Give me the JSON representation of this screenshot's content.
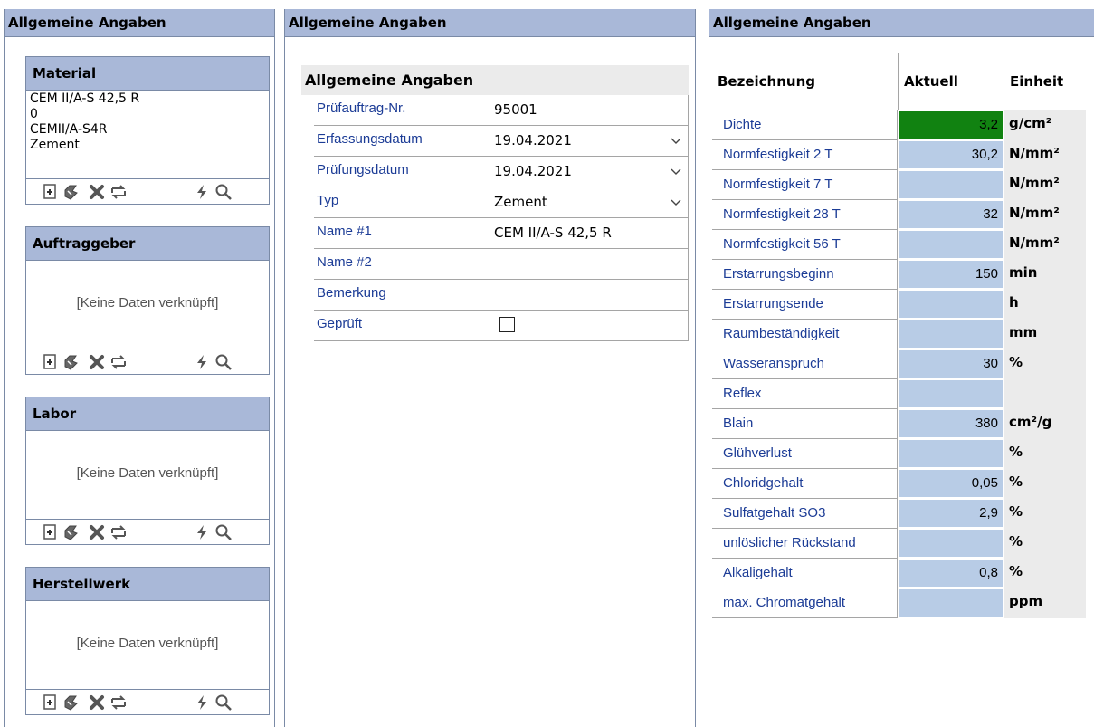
{
  "panels": {
    "left_title": "Allgemeine Angaben",
    "middle_title": "Allgemeine Angaben",
    "right_title": "Allgemeine Angaben"
  },
  "material": {
    "title": "Material",
    "lines": [
      "CEM II/A-S 42,5 R",
      "0",
      "CEMII/A-S4R",
      "Zement"
    ]
  },
  "auftraggeber": {
    "title": "Auftraggeber",
    "empty": "[Keine Daten verknüpft]"
  },
  "labor": {
    "title": "Labor",
    "empty": "[Keine Daten verknüpft]"
  },
  "herstellwerk": {
    "title": "Herstellwerk",
    "empty": "[Keine Daten verknüpft]"
  },
  "toolbar_icons": [
    "add-icon",
    "link-icon",
    "delete-icon",
    "swap-icon",
    "lightning-icon",
    "search-icon"
  ],
  "form": {
    "title": "Allgemeine Angaben",
    "rows": [
      {
        "label": "Prüfauftrag-Nr.",
        "value": "95001"
      },
      {
        "label": "Erfassungsdatum",
        "value": "19.04.2021"
      },
      {
        "label": "Prüfungsdatum",
        "value": "19.04.2021"
      },
      {
        "label": "Typ",
        "value": "Zement"
      },
      {
        "label": "Name #1",
        "value": "CEM II/A-S 42,5 R"
      },
      {
        "label": "Name #2",
        "value": ""
      },
      {
        "label": "Bemerkung",
        "value": ""
      },
      {
        "label": "Geprüft",
        "value": ""
      }
    ]
  },
  "table": {
    "headers": [
      "Bezeichnung",
      "Aktuell",
      "Einheit"
    ],
    "rows": [
      {
        "name": "Dichte",
        "value": "3,2",
        "unit": "g/cm²"
      },
      {
        "name": "Normfestigkeit 2 T",
        "value": "30,2",
        "unit": "N/mm²"
      },
      {
        "name": "Normfestigkeit 7 T",
        "value": "",
        "unit": "N/mm²"
      },
      {
        "name": "Normfestigkeit 28 T",
        "value": "32",
        "unit": "N/mm²"
      },
      {
        "name": "Normfestigkeit 56 T",
        "value": "",
        "unit": "N/mm²"
      },
      {
        "name": "Erstarrungsbeginn",
        "value": "150",
        "unit": "min"
      },
      {
        "name": "Erstarrungsende",
        "value": "",
        "unit": "h"
      },
      {
        "name": "Raumbeständigkeit",
        "value": "",
        "unit": "mm"
      },
      {
        "name": "Wasseranspruch",
        "value": "30",
        "unit": "%"
      },
      {
        "name": "Reflex",
        "value": "",
        "unit": ""
      },
      {
        "name": "Blain",
        "value": "380",
        "unit": "cm²/g"
      },
      {
        "name": "Glühverlust",
        "value": "",
        "unit": "%"
      },
      {
        "name": "Chloridgehalt",
        "value": "0,05",
        "unit": "%"
      },
      {
        "name": "Sulfatgehalt SO3",
        "value": "2,9",
        "unit": "%"
      },
      {
        "name": "unlöslicher Rückstand",
        "value": "",
        "unit": "%"
      },
      {
        "name": "Alkaligehalt",
        "value": "0,8",
        "unit": "%"
      },
      {
        "name": "max. Chromatgehalt",
        "value": "",
        "unit": "ppm"
      }
    ],
    "highlight_color": "#118211",
    "value_cell_color": "#b8cce6"
  }
}
